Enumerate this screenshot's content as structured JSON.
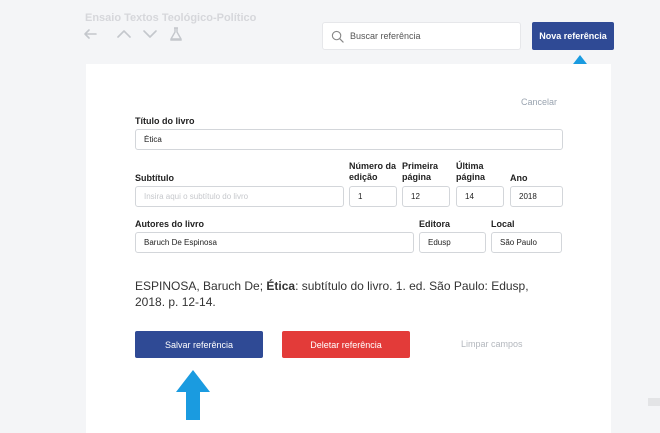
{
  "document": {
    "title": "Ensaio Textos Teológico-Político"
  },
  "toolbar": {
    "icons": [
      "back-arrow-icon",
      "chevron-up-icon",
      "chevron-down-icon",
      "flask-icon"
    ]
  },
  "search": {
    "placeholder": "Buscar referência",
    "value": ""
  },
  "actions": {
    "new_reference_label": "Nova referência"
  },
  "form": {
    "cancel_label": "Cancelar",
    "book_title": {
      "label": "Título do livro",
      "value": "Ética"
    },
    "subtitle": {
      "label": "Subtítulo",
      "placeholder": "Insira aqui o subtítulo do livro",
      "value": ""
    },
    "edition": {
      "label_line1": "Número da",
      "label_line2": "edição",
      "value": "1"
    },
    "first_page": {
      "label_line1": "Primeira",
      "label_line2": "página",
      "value": "12"
    },
    "last_page": {
      "label_line1": "Última",
      "label_line2": "página",
      "value": "14"
    },
    "year": {
      "label": "Ano",
      "value": "2018"
    },
    "authors": {
      "label": "Autores do livro",
      "value": "Baruch De Espinosa"
    },
    "publisher": {
      "label": "Editora",
      "value": "Edusp"
    },
    "location": {
      "label": "Local",
      "value": "São Paulo"
    }
  },
  "citation": {
    "before": "ESPINOSA, Baruch De; ",
    "title": "Ética",
    "after": ": subtítulo do livro. 1. ed. São Paulo: Edusp, 2018. p. 12-14."
  },
  "buttons": {
    "save_label": "Salvar referência",
    "delete_label": "Deletar referência",
    "clear_label": "Limpar campos"
  },
  "colors": {
    "primary": "#2f4a95",
    "danger": "#e33b39",
    "annotation_arrow": "#1a9be0",
    "background": "#f4f5f7"
  }
}
